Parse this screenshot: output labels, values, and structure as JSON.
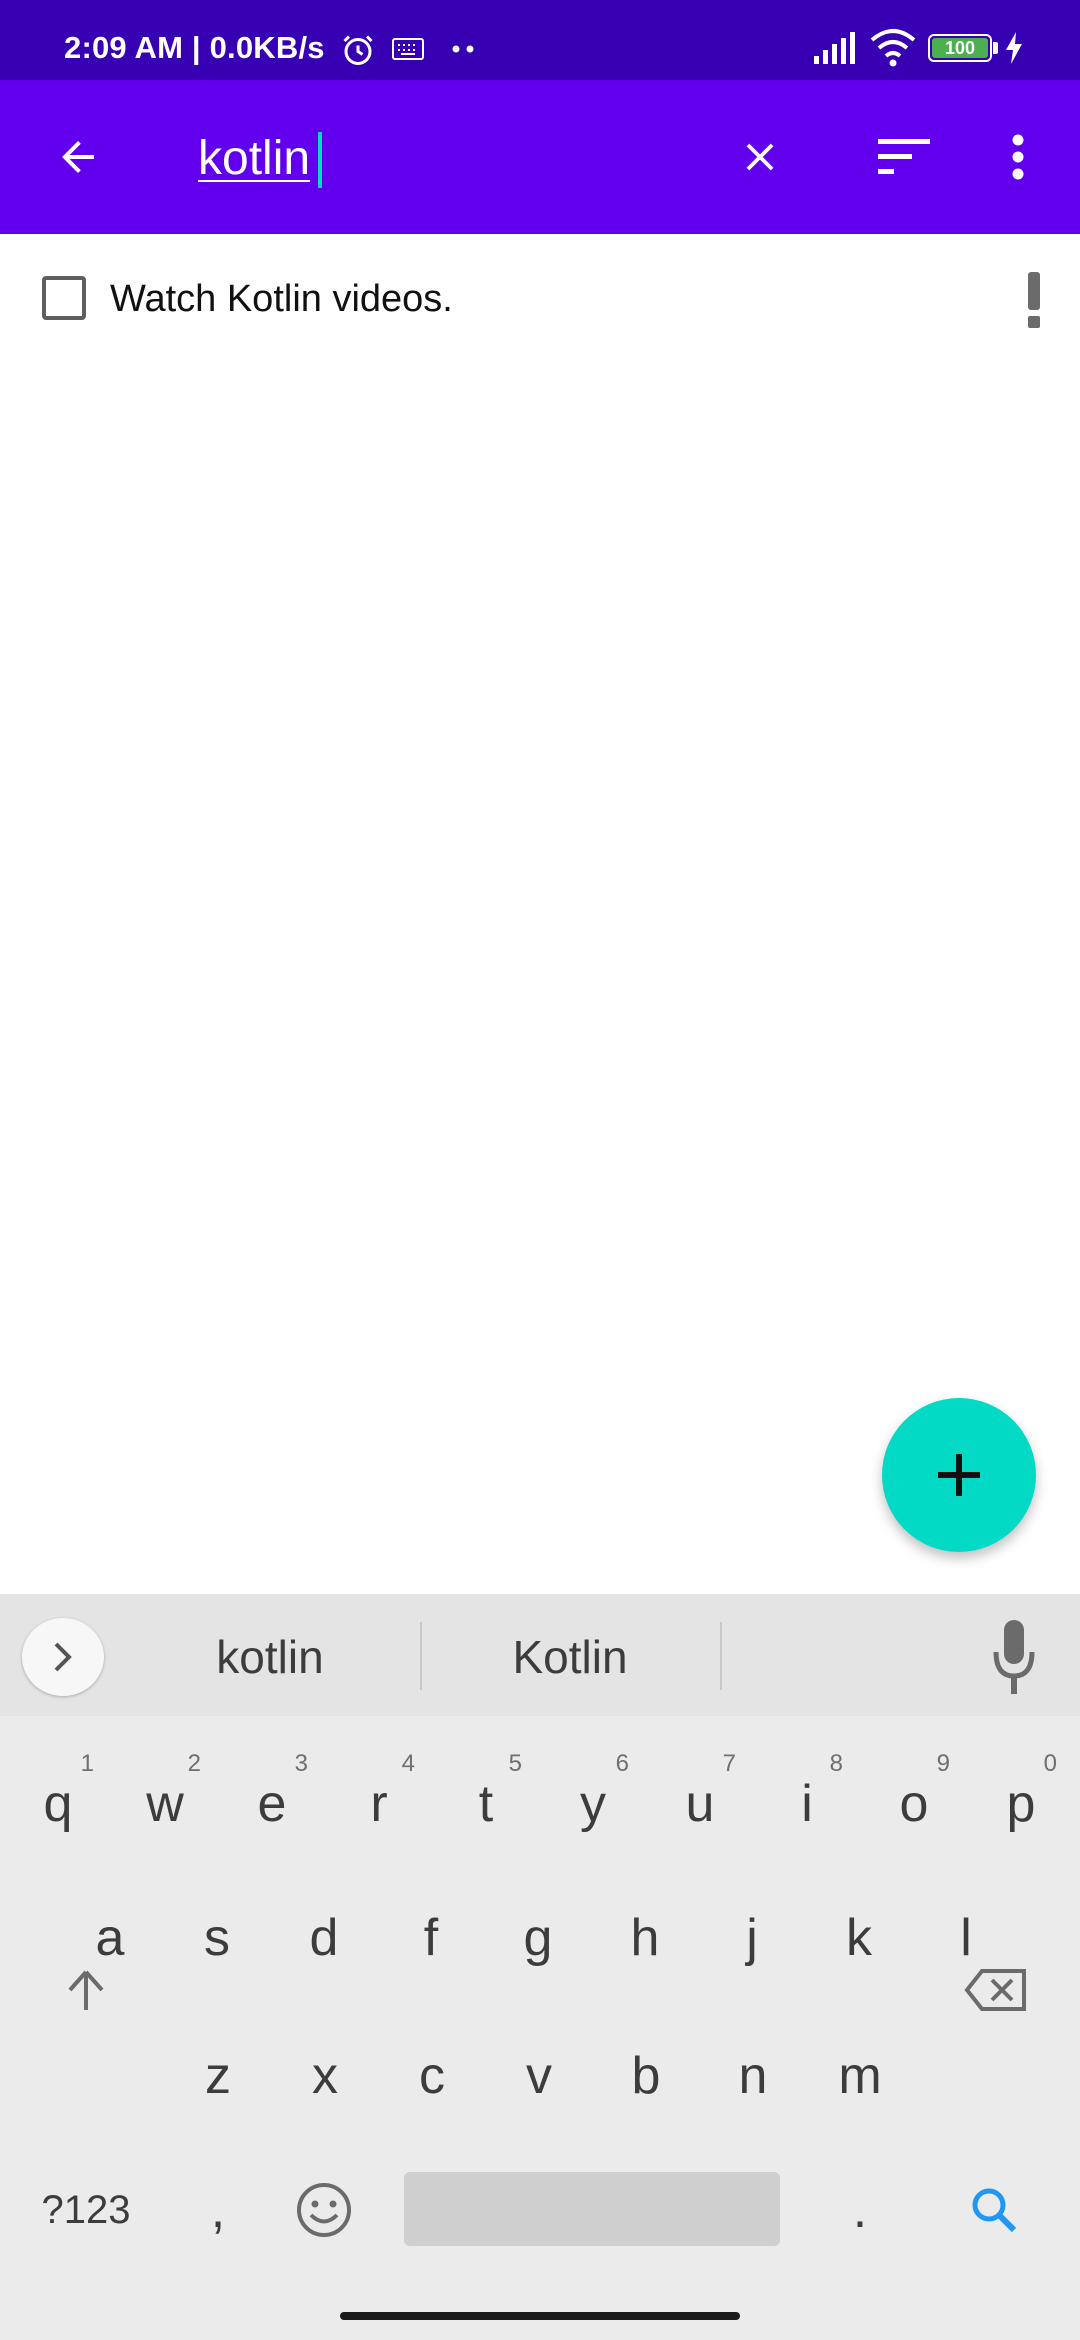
{
  "status_bar": {
    "time_text": "2:09 AM | 0.0KB/s",
    "battery": "100"
  },
  "search": {
    "query": "kotlin"
  },
  "tasks": [
    {
      "title": "Watch Kotlin videos.",
      "checked": false,
      "priority": "high"
    }
  ],
  "keyboard": {
    "suggestions": [
      "kotlin",
      "Kotlin"
    ],
    "row1": [
      {
        "k": "q",
        "h": "1"
      },
      {
        "k": "w",
        "h": "2"
      },
      {
        "k": "e",
        "h": "3"
      },
      {
        "k": "r",
        "h": "4"
      },
      {
        "k": "t",
        "h": "5"
      },
      {
        "k": "y",
        "h": "6"
      },
      {
        "k": "u",
        "h": "7"
      },
      {
        "k": "i",
        "h": "8"
      },
      {
        "k": "o",
        "h": "9"
      },
      {
        "k": "p",
        "h": "0"
      }
    ],
    "row2": [
      "a",
      "s",
      "d",
      "f",
      "g",
      "h",
      "j",
      "k",
      "l"
    ],
    "row3": [
      "z",
      "x",
      "c",
      "v",
      "b",
      "n",
      "m"
    ],
    "numbers_label": "?123",
    "comma": ",",
    "period": "."
  },
  "colors": {
    "status_bar": "#3700b3",
    "app_bar": "#6200ee",
    "fab": "#03dac5",
    "search_key": "#2196f3"
  },
  "icons": [
    "back-arrow-icon",
    "clear-icon",
    "sort-icon",
    "more-vert-icon",
    "priority-exclamation-icon",
    "add-icon",
    "expand-icon",
    "mic-icon",
    "shift-icon",
    "backspace-icon",
    "emoji-icon",
    "search-icon"
  ]
}
